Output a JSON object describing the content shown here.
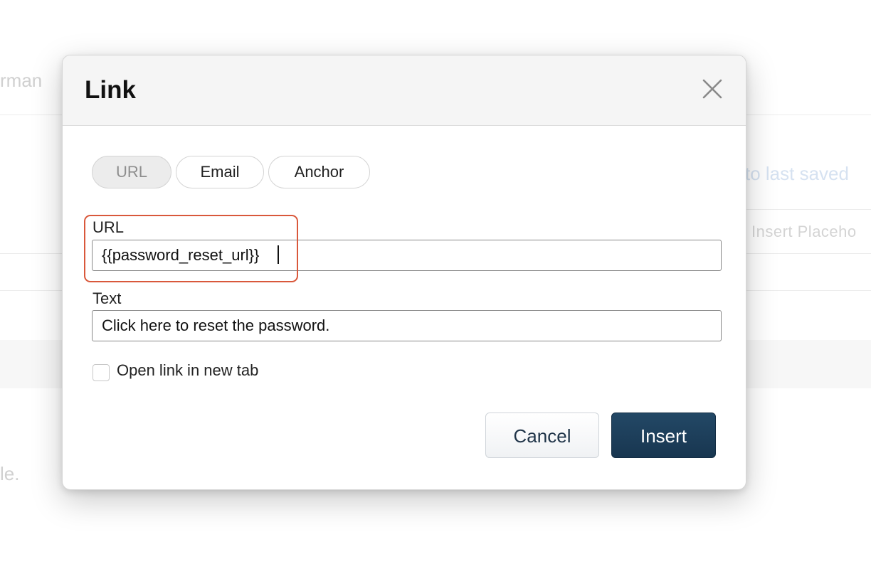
{
  "background": {
    "fragment_left_top": "rman",
    "fragment_left_bottom": "le.",
    "fragment_right_link": "to last saved",
    "fragment_right_button": "Insert Placeho"
  },
  "dialog": {
    "title": "Link",
    "close_icon": "close-icon",
    "tabs": [
      {
        "label": "URL",
        "active": true
      },
      {
        "label": "Email",
        "active": false
      },
      {
        "label": "Anchor",
        "active": false
      }
    ],
    "url_field": {
      "label": "URL",
      "value": "{{password_reset_url}}"
    },
    "text_field": {
      "label": "Text",
      "value": "Click here to reset the password."
    },
    "new_tab_checkbox": {
      "label": "Open link in new tab",
      "checked": false
    },
    "cancel_label": "Cancel",
    "insert_label": "Insert"
  },
  "colors": {
    "primary": "#1b3a56",
    "highlight": "#d9583b"
  }
}
